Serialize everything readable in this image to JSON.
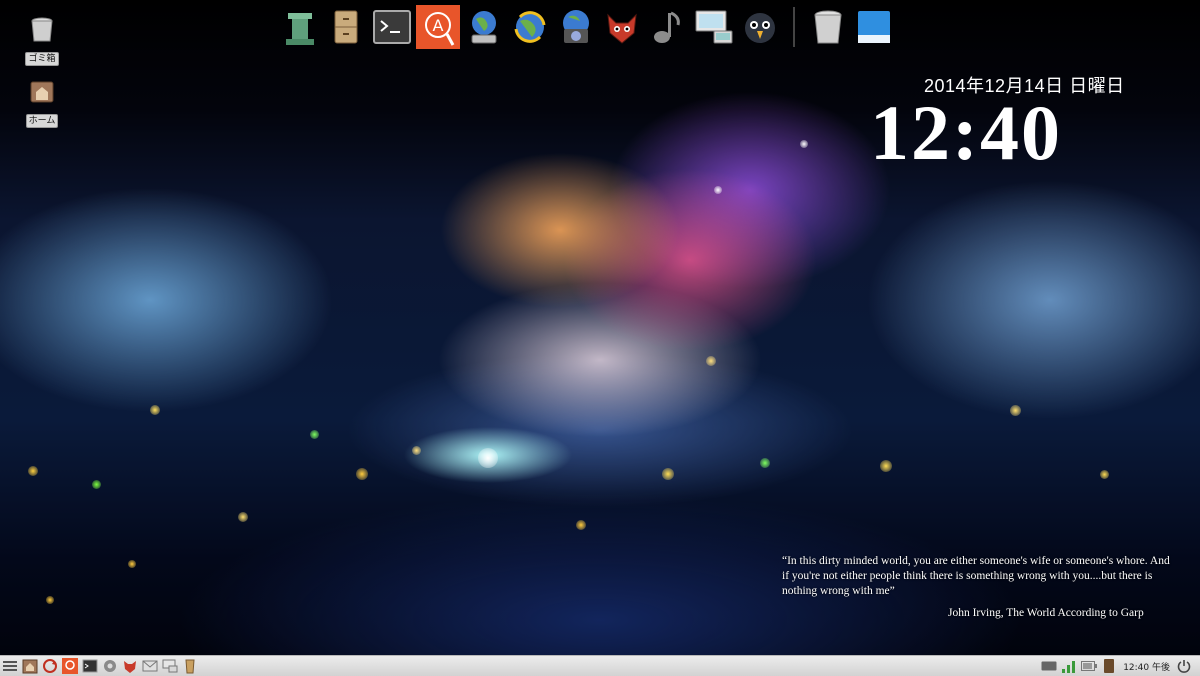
{
  "desktop": {
    "icons": [
      {
        "label": "ゴミ箱",
        "icon": "trash-icon"
      },
      {
        "label": "ホーム",
        "icon": "home-folder-icon"
      }
    ]
  },
  "dock": {
    "items": [
      {
        "name": "column-icon"
      },
      {
        "name": "cabinet-icon"
      },
      {
        "name": "terminal-icon"
      },
      {
        "name": "software-center-icon"
      },
      {
        "name": "globe-network-icon"
      },
      {
        "name": "sync-globe-icon"
      },
      {
        "name": "globe-camera-icon"
      },
      {
        "name": "fox-icon"
      },
      {
        "name": "music-note-icon"
      },
      {
        "name": "remote-desktop-icon"
      },
      {
        "name": "bird-icon"
      },
      {
        "name": "trash-can-icon"
      },
      {
        "name": "window-icon"
      }
    ]
  },
  "clock": {
    "date": "2014年12月14日  日曜日",
    "time": "12:40"
  },
  "quote": {
    "text": "“In this dirty minded world, you are either someone's wife or someone's whore. And if you're not either people think there is something wrong with you....but there is nothing wrong with me”",
    "author": "John Irving, The World According to Garp"
  },
  "taskbar": {
    "launchers": [
      "menu-icon",
      "home-icon",
      "sync-icon",
      "software-icon",
      "terminal-icon",
      "settings-icon",
      "fox-icon",
      "mail-icon",
      "remote-icon",
      "drink-icon"
    ],
    "tray_time": "12:40 午後"
  },
  "colors": {
    "accent_orange": "#e8552a",
    "taskbar_bg": "#dcdcdc"
  }
}
